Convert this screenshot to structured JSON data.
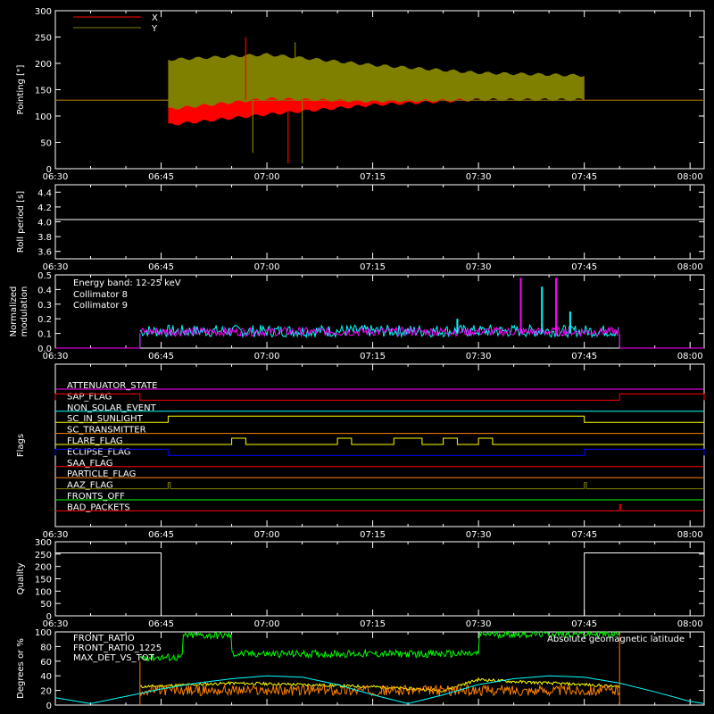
{
  "chart_data": [
    {
      "type": "line",
      "name": "pointing",
      "ylabel": "Pointing [\"]",
      "ylim": [
        0,
        300
      ],
      "yticks": [
        "0",
        "50",
        "100",
        "150",
        "200",
        "250",
        "300"
      ],
      "x_ticks": [
        "06:30",
        "06:45",
        "07:00",
        "07:15",
        "07:30",
        "07:45",
        "08:00"
      ],
      "show_x_tick_labels": true,
      "xlim": [
        "06:30",
        "08:02"
      ],
      "legend_position": "top-left",
      "series": [
        {
          "name": "X",
          "color": "#ff0000",
          "baseline": 130,
          "band_start": "06:46",
          "band_end": "07:45",
          "envelope_low": [
            [
              "06:46",
              80
            ],
            [
              "07:00",
              100
            ],
            [
              "07:15",
              118
            ],
            [
              "07:30",
              128
            ],
            [
              "07:45",
              130
            ]
          ],
          "envelope_high": [
            [
              "06:46",
              135
            ],
            [
              "07:00",
              155
            ],
            [
              "07:15",
              165
            ],
            [
              "07:30",
              175
            ],
            [
              "07:45",
              180
            ]
          ]
        },
        {
          "name": "Y",
          "color": "#808000",
          "baseline": 130,
          "band_start": "06:46",
          "band_end": "07:45",
          "envelope_low": [
            [
              "06:46",
              110
            ],
            [
              "07:00",
              130
            ],
            [
              "07:15",
              125
            ],
            [
              "07:30",
              128
            ],
            [
              "07:45",
              128
            ]
          ],
          "envelope_high": [
            [
              "06:46",
              210
            ],
            [
              "07:00",
              220
            ],
            [
              "07:15",
              200
            ],
            [
              "07:30",
              185
            ],
            [
              "07:45",
              180
            ]
          ]
        }
      ],
      "spikes": [
        [
          "06:57",
          250,
          "#ff0000"
        ],
        [
          "06:58",
          30,
          "#808000"
        ],
        [
          "07:03",
          10,
          "#ff0000"
        ],
        [
          "07:04",
          240,
          "#808000"
        ],
        [
          "07:05",
          10,
          "#808000"
        ]
      ]
    },
    {
      "type": "line",
      "name": "roll-period",
      "ylabel": "Roll period [s]",
      "ylim": [
        3.5,
        4.5
      ],
      "yticks": [
        "3.6",
        "3.8",
        "4.0",
        "4.2",
        "4.4"
      ],
      "x_ticks": [
        "06:30",
        "06:45",
        "07:00",
        "07:15",
        "07:30",
        "07:45",
        "08:00"
      ],
      "show_x_tick_labels": true,
      "series": [
        {
          "name": "",
          "color": "#ffffff",
          "x": [
            "06:30",
            "08:02"
          ],
          "y": [
            4.03,
            4.03
          ]
        }
      ]
    },
    {
      "type": "line",
      "name": "modulation",
      "ylabel": "Normalized modulation",
      "ylim": [
        0,
        0.5
      ],
      "yticks": [
        "0.0",
        "0.1",
        "0.2",
        "0.3",
        "0.4",
        "0.5"
      ],
      "x_ticks": [
        "06:30",
        "06:45",
        "07:00",
        "07:15",
        "07:30",
        "07:45",
        "08:00"
      ],
      "show_x_tick_labels": true,
      "annotation": "Energy band: 12-25 keV",
      "series": [
        {
          "name": "Collimator 8",
          "color": "#00ffff",
          "start": "06:42",
          "end": "07:50",
          "level": 0.1
        },
        {
          "name": "Collimator 9",
          "color": "#ff00ff",
          "start": "06:42",
          "end": "07:50",
          "level": 0.1
        }
      ],
      "spikes": [
        [
          "07:36",
          0.48,
          "#ff00ff"
        ],
        [
          "07:39",
          0.42,
          "#00ffff"
        ],
        [
          "07:41",
          0.48,
          "#ff00ff"
        ],
        [
          "07:43",
          0.25,
          "#00ffff"
        ],
        [
          "07:27",
          0.2,
          "#00ffff"
        ]
      ]
    },
    {
      "type": "line",
      "name": "flags",
      "ylabel": "Flags",
      "x_ticks": [
        "06:30",
        "06:45",
        "07:00",
        "07:15",
        "07:30",
        "07:45",
        "08:00"
      ],
      "show_x_tick_labels": true,
      "flags": [
        {
          "label": "ATTENUATOR_STATE",
          "color": "#ff00ff",
          "segments": []
        },
        {
          "label": "SAP_FLAG",
          "color": "#ff0000",
          "segments": [
            [
              "06:30",
              "06:42"
            ],
            [
              "07:50",
              "08:02"
            ]
          ]
        },
        {
          "label": "NON_SOLAR_EVENT",
          "color": "#00ffff",
          "segments": []
        },
        {
          "label": "SC_IN_SUNLIGHT",
          "color": "#ffff00",
          "segments": [
            [
              "06:46",
              "07:45"
            ]
          ]
        },
        {
          "label": "SC_TRANSMITTER",
          "color": "#ff8000",
          "segments": []
        },
        {
          "label": "FLARE_FLAG",
          "color": "#ffff00",
          "segments": [
            [
              "06:55",
              "06:57"
            ],
            [
              "07:10",
              "07:12"
            ],
            [
              "07:18",
              "07:22"
            ],
            [
              "07:25",
              "07:27"
            ],
            [
              "07:30",
              "07:32"
            ]
          ]
        },
        {
          "label": "ECLIPSE_FLAG",
          "color": "#0000ff",
          "segments": [
            [
              "06:30",
              "06:46"
            ],
            [
              "07:45",
              "08:02"
            ]
          ]
        },
        {
          "label": "SAA_FLAG",
          "color": "#ff0000",
          "segments": []
        },
        {
          "label": "PARTICLE_FLAG",
          "color": "#ff8000",
          "segments": []
        },
        {
          "label": "AAZ_FLAG",
          "color": "#808000",
          "segments": [
            [
              "06:46",
              "06:46.3"
            ],
            [
              "07:45",
              "07:45.3"
            ]
          ]
        },
        {
          "label": "FRONTS_OFF",
          "color": "#00ff00",
          "segments": []
        },
        {
          "label": "BAD_PACKETS",
          "color": "#ff0000",
          "segments": [
            [
              "07:50",
              "07:50.2"
            ]
          ]
        }
      ]
    },
    {
      "type": "line",
      "name": "quality",
      "ylabel": "Quality",
      "ylim": [
        0,
        300
      ],
      "yticks": [
        "0",
        "50",
        "100",
        "150",
        "200",
        "250",
        "300"
      ],
      "x_ticks": [
        "06:30",
        "06:45",
        "07:00",
        "07:15",
        "07:30",
        "07:45",
        "08:00"
      ],
      "show_x_tick_labels": true,
      "series": [
        {
          "name": "",
          "color": "#ffffff",
          "x": [
            "06:30",
            "06:45",
            "06:45",
            "07:45",
            "07:45",
            "08:02"
          ],
          "y": [
            255,
            255,
            0,
            0,
            255,
            255
          ]
        }
      ]
    },
    {
      "type": "line",
      "name": "ratios",
      "ylabel": "Degrees or %",
      "ylim": [
        0,
        100
      ],
      "yticks": [
        "0",
        "20",
        "40",
        "60",
        "80",
        "100"
      ],
      "x_ticks": [
        "06:30",
        "06:45",
        "07:00",
        "07:15",
        "07:30",
        "07:45",
        "08:00"
      ],
      "show_x_tick_labels": false,
      "series": [
        {
          "name": "FRONT_RATIO",
          "color": "#ffff00",
          "x": [
            "06:42",
            "06:55",
            "07:05",
            "07:15",
            "07:25",
            "07:30",
            "07:35",
            "07:45",
            "07:50"
          ],
          "y": [
            25,
            30,
            28,
            25,
            20,
            35,
            32,
            28,
            25
          ]
        },
        {
          "name": "FRONT_RATIO_1225",
          "color": "#00ff00",
          "x": [
            "06:42",
            "06:48",
            "06:48",
            "06:55",
            "06:55",
            "07:30",
            "07:30",
            "07:50"
          ],
          "y": [
            65,
            65,
            95,
            95,
            70,
            70,
            97,
            97
          ]
        },
        {
          "name": "MAX_DET_VS_TOT",
          "color": "#ff8000",
          "x": [
            "06:42",
            "07:50"
          ],
          "y": [
            20,
            20
          ]
        },
        {
          "name": "Absolute geomagnetic latitude",
          "color": "#00ffff",
          "x": [
            "06:30",
            "06:35",
            "06:40",
            "06:45",
            "06:50",
            "06:55",
            "07:00",
            "07:05",
            "07:10",
            "07:15",
            "07:20",
            "07:25",
            "07:30",
            "07:35",
            "07:40",
            "07:45",
            "07:50",
            "07:55",
            "08:00",
            "08:02"
          ],
          "y": [
            10,
            2,
            12,
            22,
            30,
            36,
            40,
            38,
            28,
            14,
            2,
            14,
            28,
            36,
            40,
            38,
            30,
            18,
            5,
            2
          ]
        }
      ]
    }
  ]
}
